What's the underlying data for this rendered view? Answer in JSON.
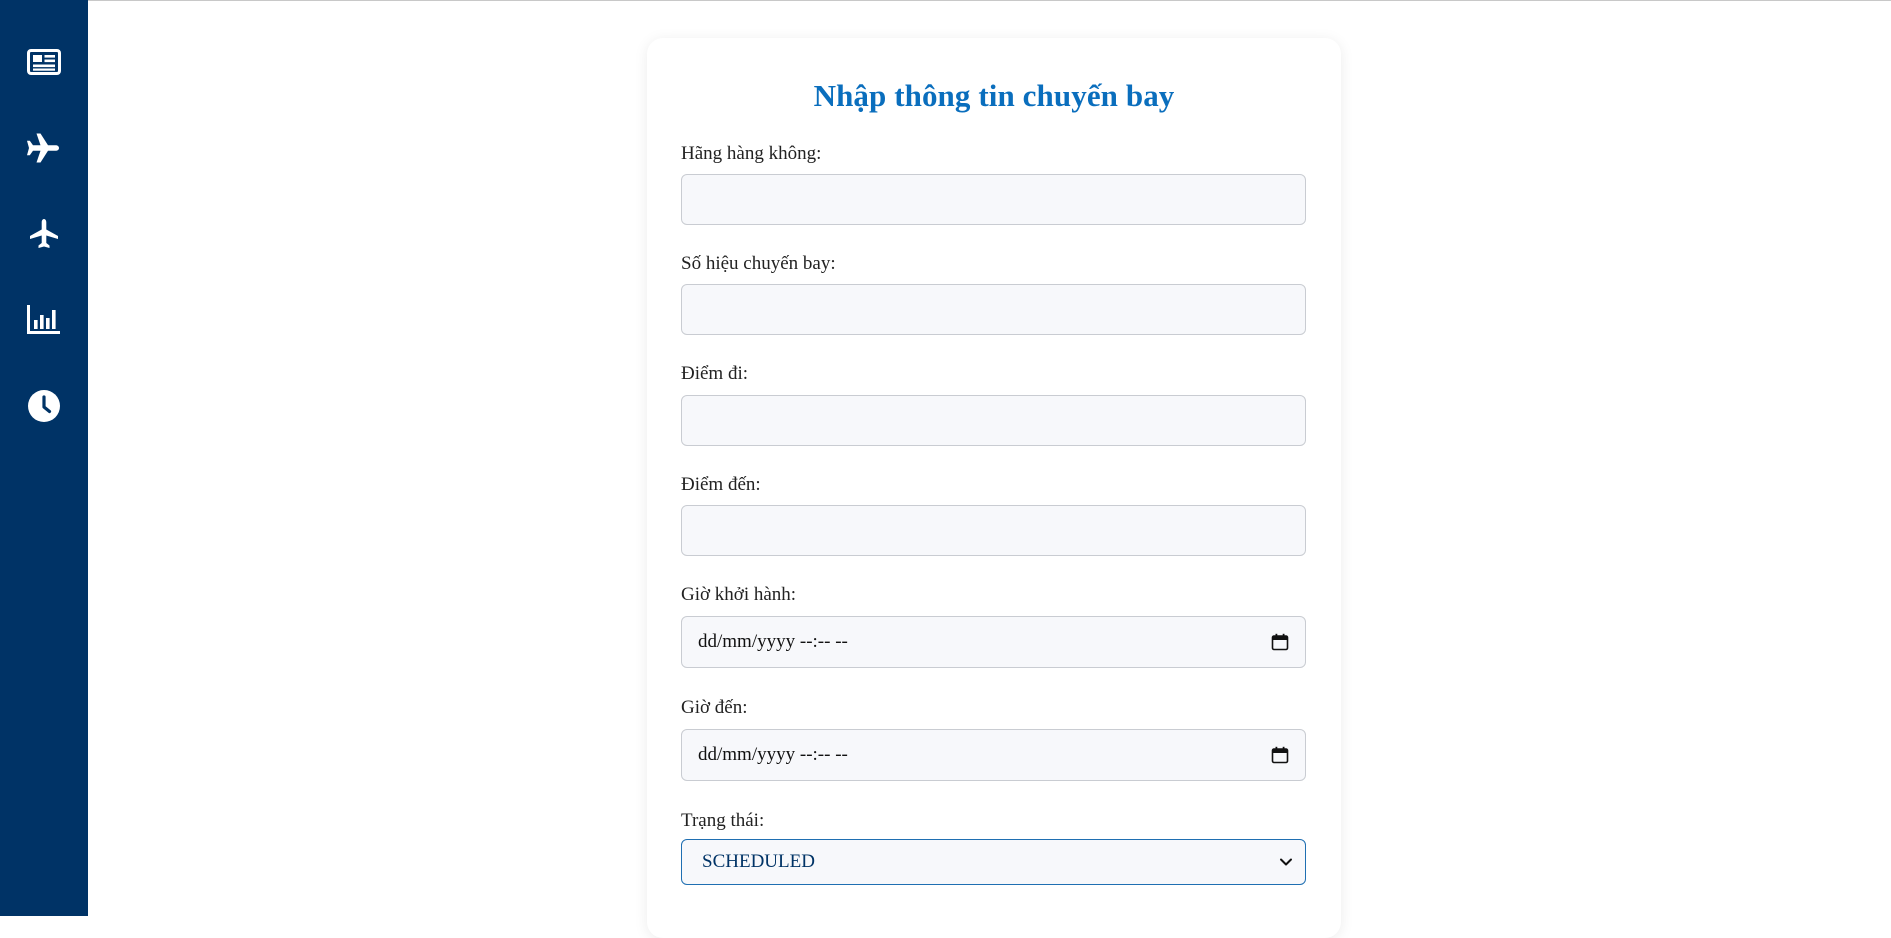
{
  "sidebar": {
    "items": [
      {
        "icon": "newspaper-icon"
      },
      {
        "icon": "plane-icon"
      },
      {
        "icon": "plane-top-icon"
      },
      {
        "icon": "chart-bar-icon"
      },
      {
        "icon": "clock-icon"
      }
    ],
    "background_color": "#003366",
    "icon_color": "#ffffff"
  },
  "form": {
    "title": "Nhập thông tin chuyến bay",
    "title_color": "#0a6ebd",
    "fields": {
      "airline": {
        "label": "Hãng hàng không:",
        "value": ""
      },
      "flight_number": {
        "label": "Số hiệu chuyến bay:",
        "value": ""
      },
      "origin": {
        "label": "Điểm đi:",
        "value": ""
      },
      "destination": {
        "label": "Điểm đến:",
        "value": ""
      },
      "departure_time": {
        "label": "Giờ khởi hành:",
        "value": "dd/mm/yyyy --:-- --"
      },
      "arrival_time": {
        "label": "Giờ đến:",
        "value": "dd/mm/yyyy --:-- --"
      },
      "status": {
        "label": "Trạng thái:",
        "value": "SCHEDULED"
      }
    }
  }
}
